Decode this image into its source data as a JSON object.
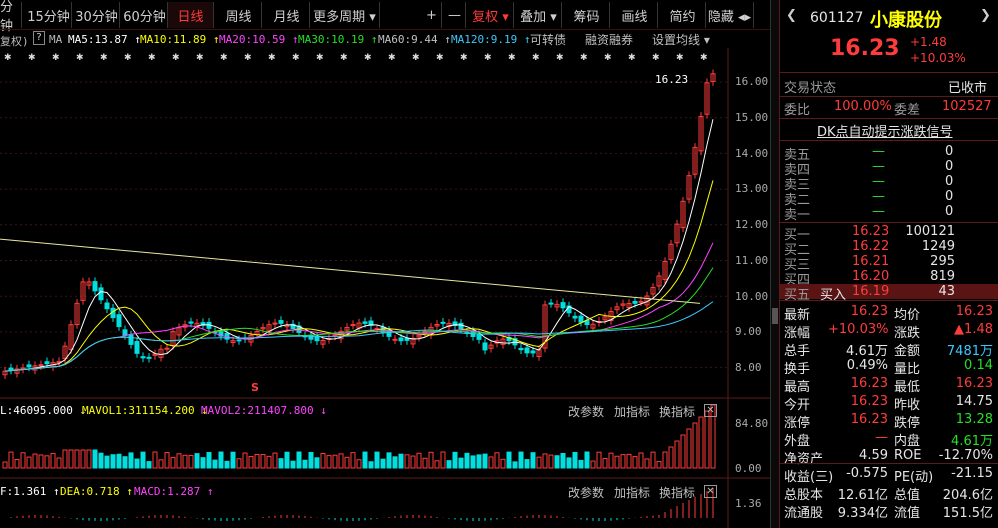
{
  "toolbar": {
    "items": [
      "分钟",
      "15分钟",
      "30分钟",
      "60分钟",
      "日线",
      "周线",
      "月线",
      "更多周期 ▾"
    ],
    "active": "日线",
    "right": [
      "+",
      "—",
      "复权 ▾",
      "叠加 ▾",
      "筹码",
      "画线",
      "简约",
      "隐藏 ◂▸"
    ]
  },
  "indicator_ma": {
    "prefix": "复权)",
    "ma": "MA",
    "ma5": "MA5:13.87 ↑",
    "ma10": "MA10:11.89 ↑",
    "ma20": "MA20:10.59 ↑",
    "ma30": "MA30:10.19 ↑",
    "ma60": "MA60:9.44 ↑",
    "ma120": "MA120:9.19 ↑",
    "links": [
      "可转债",
      "融资融券",
      "设置均线 ▾"
    ]
  },
  "price_axis": [
    "16.00",
    "15.00",
    "14.00",
    "13.00",
    "12.00",
    "11.00",
    "10.00",
    "9.00",
    "8.00"
  ],
  "price_label": "16.23",
  "signal_mark": "S",
  "vol": {
    "vol": "L:46095.000 ↓",
    "mavol1": "MAVOL1:311154.200 ↓",
    "mavol2": "MAVOL2:211407.800 ↓",
    "axis_top": "84.80",
    "axis_bottom": "0.00",
    "buttons": [
      "改参数",
      "加指标",
      "换指标"
    ]
  },
  "macd": {
    "dif": "F:1.361 ↑",
    "dea": "DEA:0.718 ↑",
    "macd": "MACD:1.287 ↑",
    "axis_top": "1.36",
    "buttons": [
      "改参数",
      "加指标",
      "换指标"
    ]
  },
  "stock": {
    "code": "601127",
    "name": "小康股份",
    "price": "16.23",
    "change": "+1.48",
    "change_pct": "+10.03%",
    "trade_status_label": "交易状态",
    "trade_status": "已收市",
    "weibi_label": "委比",
    "weibi": "100.00%",
    "weicha_label": "委差",
    "weicha": "102527",
    "dk_link": "DK点自动提示涨跌信号"
  },
  "sell": [
    {
      "label": "卖五",
      "price": "—",
      "vol": "0"
    },
    {
      "label": "卖四",
      "price": "—",
      "vol": "0"
    },
    {
      "label": "卖三",
      "price": "—",
      "vol": "0"
    },
    {
      "label": "卖二",
      "price": "—",
      "vol": "0"
    },
    {
      "label": "卖一",
      "price": "—",
      "vol": "0"
    }
  ],
  "buy": [
    {
      "label": "买一",
      "price": "16.23",
      "vol": "100121"
    },
    {
      "label": "买二",
      "price": "16.22",
      "vol": "1249"
    },
    {
      "label": "买三",
      "price": "16.21",
      "vol": "295"
    },
    {
      "label": "买四",
      "price": "16.20",
      "vol": "819"
    },
    {
      "label": "买五",
      "price": "16.19",
      "vol": "43",
      "action": "买入"
    }
  ],
  "stats": [
    {
      "l1": "最新",
      "v1": "16.23",
      "c1": "red",
      "l2": "均价",
      "v2": "16.23",
      "c2": "red"
    },
    {
      "l1": "涨幅",
      "v1": "+10.03%",
      "c1": "red",
      "l2": "涨跌",
      "v2": "▲1.48",
      "c2": "red"
    },
    {
      "l1": "总手",
      "v1": "4.61万",
      "c1": "wht",
      "l2": "金额",
      "v2": "7481万",
      "c2": "blu"
    },
    {
      "l1": "换手",
      "v1": "0.49%",
      "c1": "wht",
      "l2": "量比",
      "v2": "0.14",
      "c2": "grn"
    },
    {
      "l1": "最高",
      "v1": "16.23",
      "c1": "red",
      "l2": "最低",
      "v2": "16.23",
      "c2": "red"
    },
    {
      "l1": "今开",
      "v1": "16.23",
      "c1": "red",
      "l2": "昨收",
      "v2": "14.75",
      "c2": "wht"
    },
    {
      "l1": "涨停",
      "v1": "16.23",
      "c1": "red",
      "l2": "跌停",
      "v2": "13.28",
      "c2": "grn"
    },
    {
      "l1": "外盘",
      "v1": "—",
      "c1": "red",
      "l2": "内盘",
      "v2": "4.61万",
      "c2": "grn"
    },
    {
      "l1": "净资产",
      "v1": "4.59",
      "c1": "wht",
      "l2": "ROE",
      "v2": "-12.70%",
      "c2": "wht"
    },
    {
      "l1": "收益(三)",
      "v1": "-0.575",
      "c1": "wht",
      "l2": "PE(动)",
      "v2": "-21.15",
      "c2": "wht"
    },
    {
      "l1": "总股本",
      "v1": "12.61亿",
      "c1": "wht",
      "l2": "总值",
      "v2": "204.6亿",
      "c2": "wht"
    },
    {
      "l1": "流通股",
      "v1": "9.334亿",
      "c1": "wht",
      "l2": "流值",
      "v2": "151.5亿",
      "c2": "wht"
    }
  ],
  "colors": {
    "up": "#ff3c3c",
    "down": "#00e0e0",
    "ma5": "#ffffff",
    "ma10": "#ffff00",
    "ma20": "#ff44ff",
    "ma30": "#26e026",
    "ma60": "#a0a0a0",
    "ma120": "#3cc8ff"
  }
}
